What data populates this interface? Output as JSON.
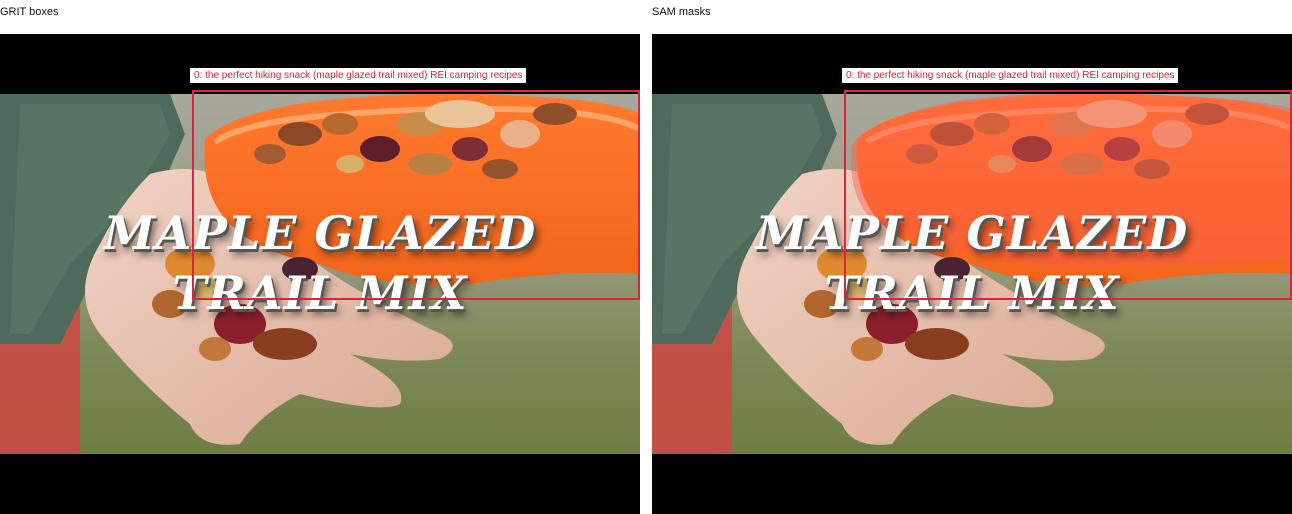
{
  "panels": {
    "left": {
      "title": "GRIT boxes"
    },
    "right": {
      "title": "SAM masks"
    }
  },
  "detection": {
    "label": "0: the perfect hiking snack (maple glazed trail mixed) REI camping recipes",
    "box_color": "#d7263d",
    "mask_color": "#ff5a4e"
  },
  "image": {
    "title_line1": "MAPLE GLAZED",
    "title_line2": "TRAIL MIX"
  }
}
